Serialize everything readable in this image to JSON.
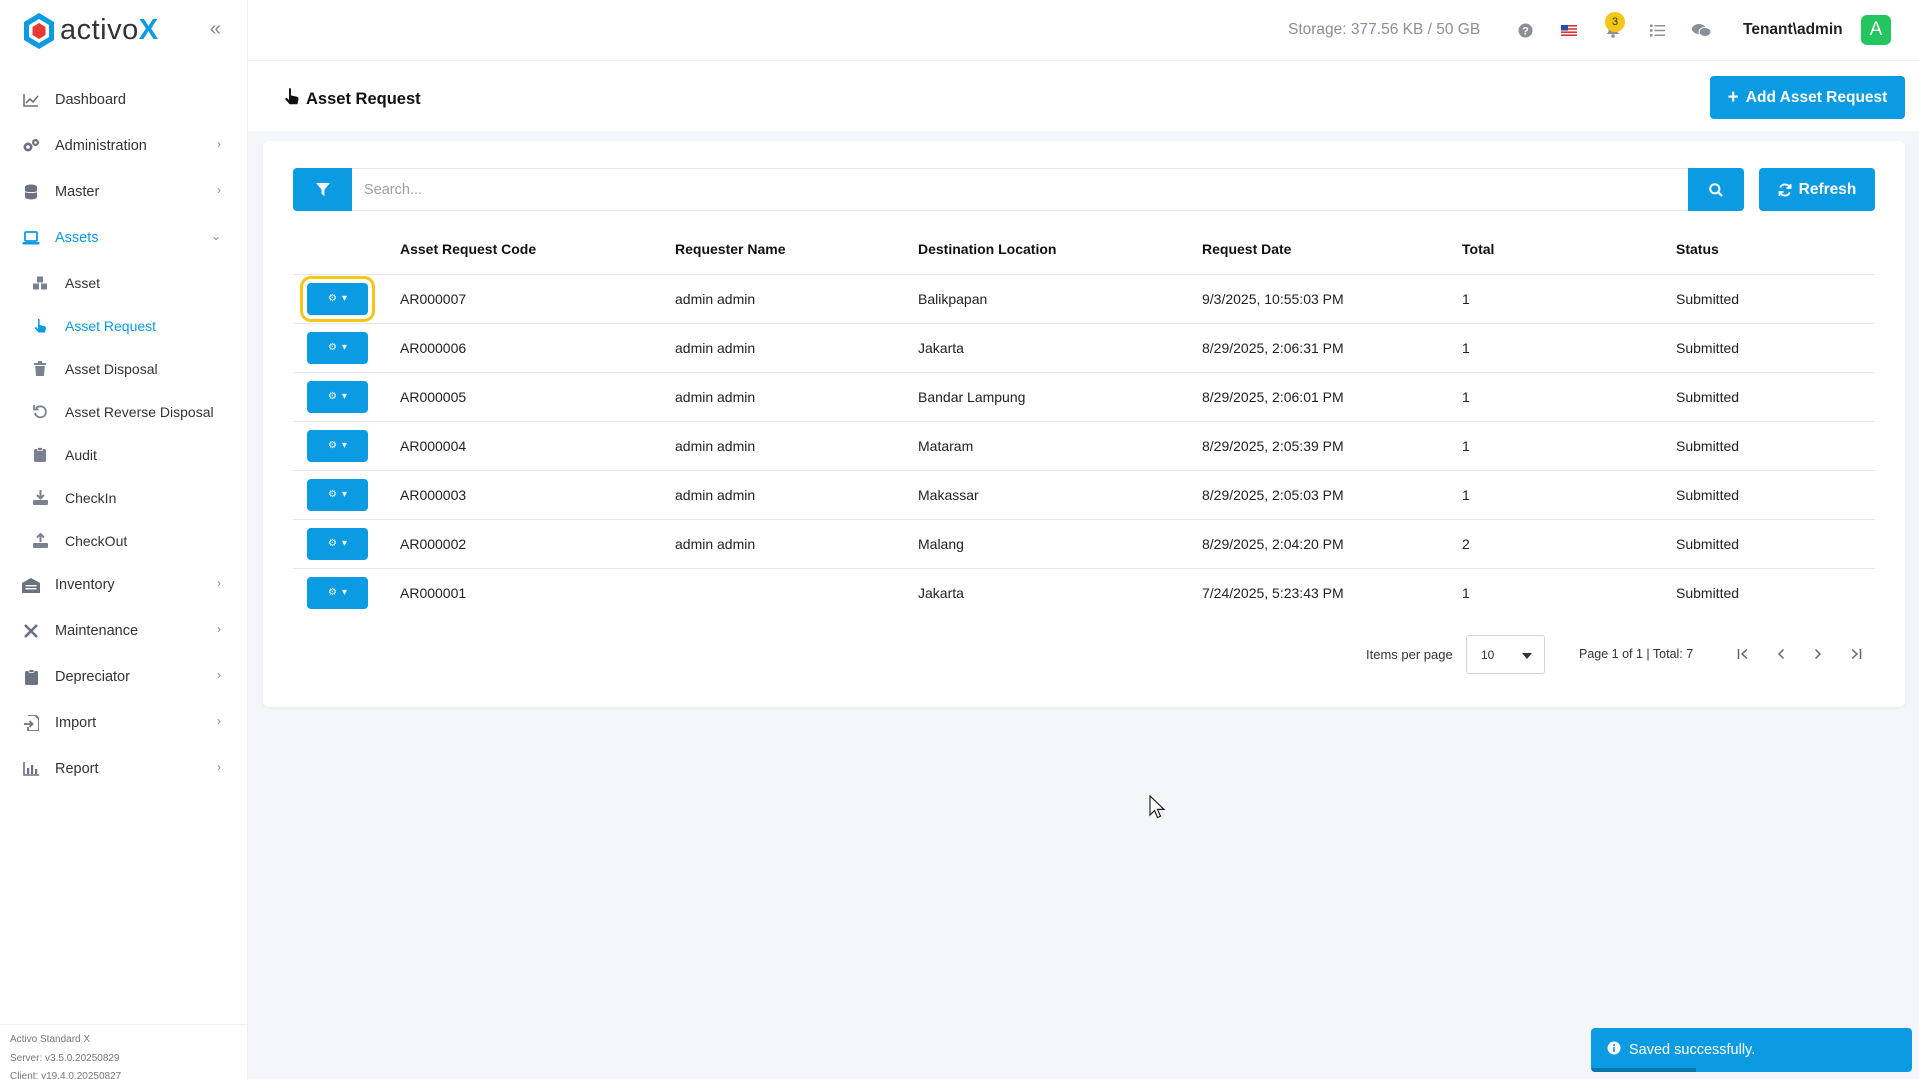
{
  "brand": {
    "name": "activo",
    "x": "X",
    "accent": "#0a9be3"
  },
  "header": {
    "storage": "Storage: 377.56 KB / 50 GB",
    "notifications_count": "3",
    "user": "Tenant\\admin",
    "avatar_letter": "A"
  },
  "sidebar": {
    "items": [
      {
        "label": "Dashboard",
        "icon": "chart-line-icon"
      },
      {
        "label": "Administration",
        "icon": "cogs-icon"
      },
      {
        "label": "Master",
        "icon": "database-icon"
      },
      {
        "label": "Assets",
        "icon": "laptop-icon"
      },
      {
        "label": "Inventory",
        "icon": "warehouse-icon"
      },
      {
        "label": "Maintenance",
        "icon": "tools-icon"
      },
      {
        "label": "Depreciator",
        "icon": "clipboard-icon"
      },
      {
        "label": "Import",
        "icon": "import-icon"
      },
      {
        "label": "Report",
        "icon": "chart-bar-icon"
      }
    ],
    "asset_sub": [
      {
        "label": "Asset",
        "icon": "cubes-icon"
      },
      {
        "label": "Asset Request",
        "icon": "hand-pointer-icon"
      },
      {
        "label": "Asset Disposal",
        "icon": "trash-icon"
      },
      {
        "label": "Asset Reverse Disposal",
        "icon": "undo-icon"
      },
      {
        "label": "Audit",
        "icon": "clipboard-check-icon"
      },
      {
        "label": "CheckIn",
        "icon": "download-icon"
      },
      {
        "label": "CheckOut",
        "icon": "upload-icon"
      }
    ],
    "footer": {
      "product": "Activo Standard X",
      "server": "Server: v3.5.0.20250829",
      "client": "Client: v19.4.0.20250827"
    }
  },
  "page": {
    "title": "Asset Request",
    "add_label": "Add Asset Request",
    "search_placeholder": "Search...",
    "refresh_label": "Refresh"
  },
  "table": {
    "columns": [
      "Asset Request Code",
      "Requester Name",
      "Destination Location",
      "Request Date",
      "Total",
      "Status"
    ],
    "rows": [
      {
        "code": "AR000007",
        "requester": "admin admin",
        "location": "Balikpapan",
        "date": "9/3/2025, 10:55:03 PM",
        "total": "1",
        "status": "Submitted"
      },
      {
        "code": "AR000006",
        "requester": "admin admin",
        "location": "Jakarta",
        "date": "8/29/2025, 2:06:31 PM",
        "total": "1",
        "status": "Submitted"
      },
      {
        "code": "AR000005",
        "requester": "admin admin",
        "location": "Bandar Lampung",
        "date": "8/29/2025, 2:06:01 PM",
        "total": "1",
        "status": "Submitted"
      },
      {
        "code": "AR000004",
        "requester": "admin admin",
        "location": "Mataram",
        "date": "8/29/2025, 2:05:39 PM",
        "total": "1",
        "status": "Submitted"
      },
      {
        "code": "AR000003",
        "requester": "admin admin",
        "location": "Makassar",
        "date": "8/29/2025, 2:05:03 PM",
        "total": "1",
        "status": "Submitted"
      },
      {
        "code": "AR000002",
        "requester": "admin admin",
        "location": "Malang",
        "date": "8/29/2025, 2:04:20 PM",
        "total": "2",
        "status": "Submitted"
      },
      {
        "code": "AR000001",
        "requester": "",
        "location": "Jakarta",
        "date": "7/24/2025, 5:23:43 PM",
        "total": "1",
        "status": "Submitted"
      }
    ]
  },
  "pager": {
    "items_per_page_label": "Items per page",
    "items_per_page": "10",
    "info": "Page 1 of 1 | Total: 7"
  },
  "toast": {
    "message": "Saved successfully."
  }
}
